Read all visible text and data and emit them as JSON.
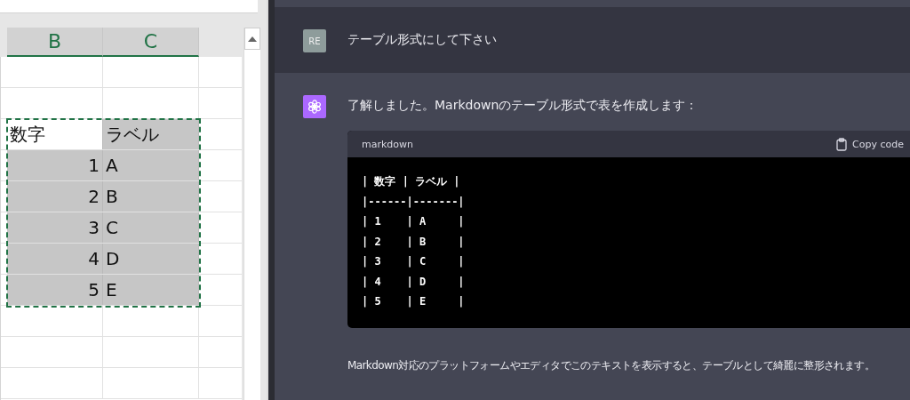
{
  "spreadsheet": {
    "columns": [
      {
        "label": "B",
        "selected": true
      },
      {
        "label": "C",
        "selected": true
      }
    ],
    "rows": [
      {
        "cells": [
          {
            "text": "数字",
            "kind": "text",
            "active": true
          },
          {
            "text": "ラベル",
            "kind": "text",
            "active": false
          }
        ]
      },
      {
        "cells": [
          {
            "text": "1",
            "kind": "number",
            "active": false
          },
          {
            "text": "A",
            "kind": "text",
            "active": false
          }
        ]
      },
      {
        "cells": [
          {
            "text": "2",
            "kind": "number",
            "active": false
          },
          {
            "text": "B",
            "kind": "text",
            "active": false
          }
        ]
      },
      {
        "cells": [
          {
            "text": "3",
            "kind": "number",
            "active": false
          },
          {
            "text": "C",
            "kind": "text",
            "active": false
          }
        ]
      },
      {
        "cells": [
          {
            "text": "4",
            "kind": "number",
            "active": false
          },
          {
            "text": "D",
            "kind": "text",
            "active": false
          }
        ]
      },
      {
        "cells": [
          {
            "text": "5",
            "kind": "number",
            "active": false
          },
          {
            "text": "E",
            "kind": "text",
            "active": false
          }
        ]
      }
    ]
  },
  "chat": {
    "messages": [
      {
        "kind": "user",
        "avatar": "RE",
        "text": "テーブル形式にして下さい"
      },
      {
        "kind": "assistant",
        "text": "了解しました。Markdownのテーブル形式で表を作成します：",
        "code": {
          "language": "markdown",
          "copy_label": "Copy code",
          "lines": [
            "| 数字 | ラベル |",
            "|------|-------|",
            "| 1    | A     |",
            "| 2    | B     |",
            "| 3    | C     |",
            "| 4    | D     |",
            "| 5    | E     |"
          ]
        },
        "after": "Markdown対応のプラットフォームやエディタでこのテキストを表示すると、テーブルとして綺麗に整形されます。"
      }
    ]
  }
}
